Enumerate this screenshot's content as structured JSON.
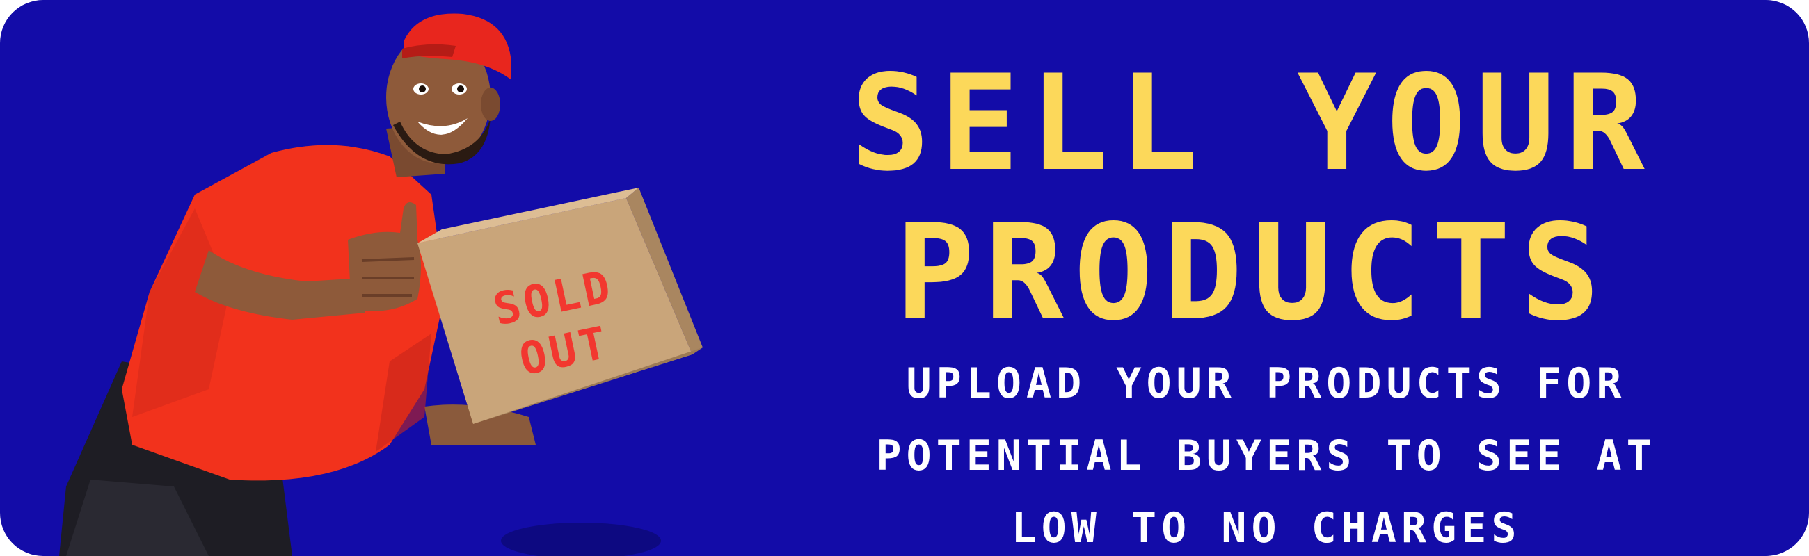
{
  "banner": {
    "headline": [
      "SELL YOUR",
      "PRODUCTS"
    ],
    "subline": [
      "UPLOAD YOUR PRODUCTS FOR",
      "POTENTIAL BUYERS TO SEE AT",
      "LOW TO NO CHARGES"
    ],
    "box_label": [
      "SOLD",
      "OUT"
    ]
  },
  "colors": {
    "background": "#130ca8",
    "headline": "#fcd85a",
    "subline": "#ffffff",
    "shirt": "#f2321c",
    "cap": "#e8261e",
    "box": "#c9a57a",
    "box_label": "#f2372f"
  },
  "icons": {
    "illustration": "delivery-man-holding-box"
  }
}
